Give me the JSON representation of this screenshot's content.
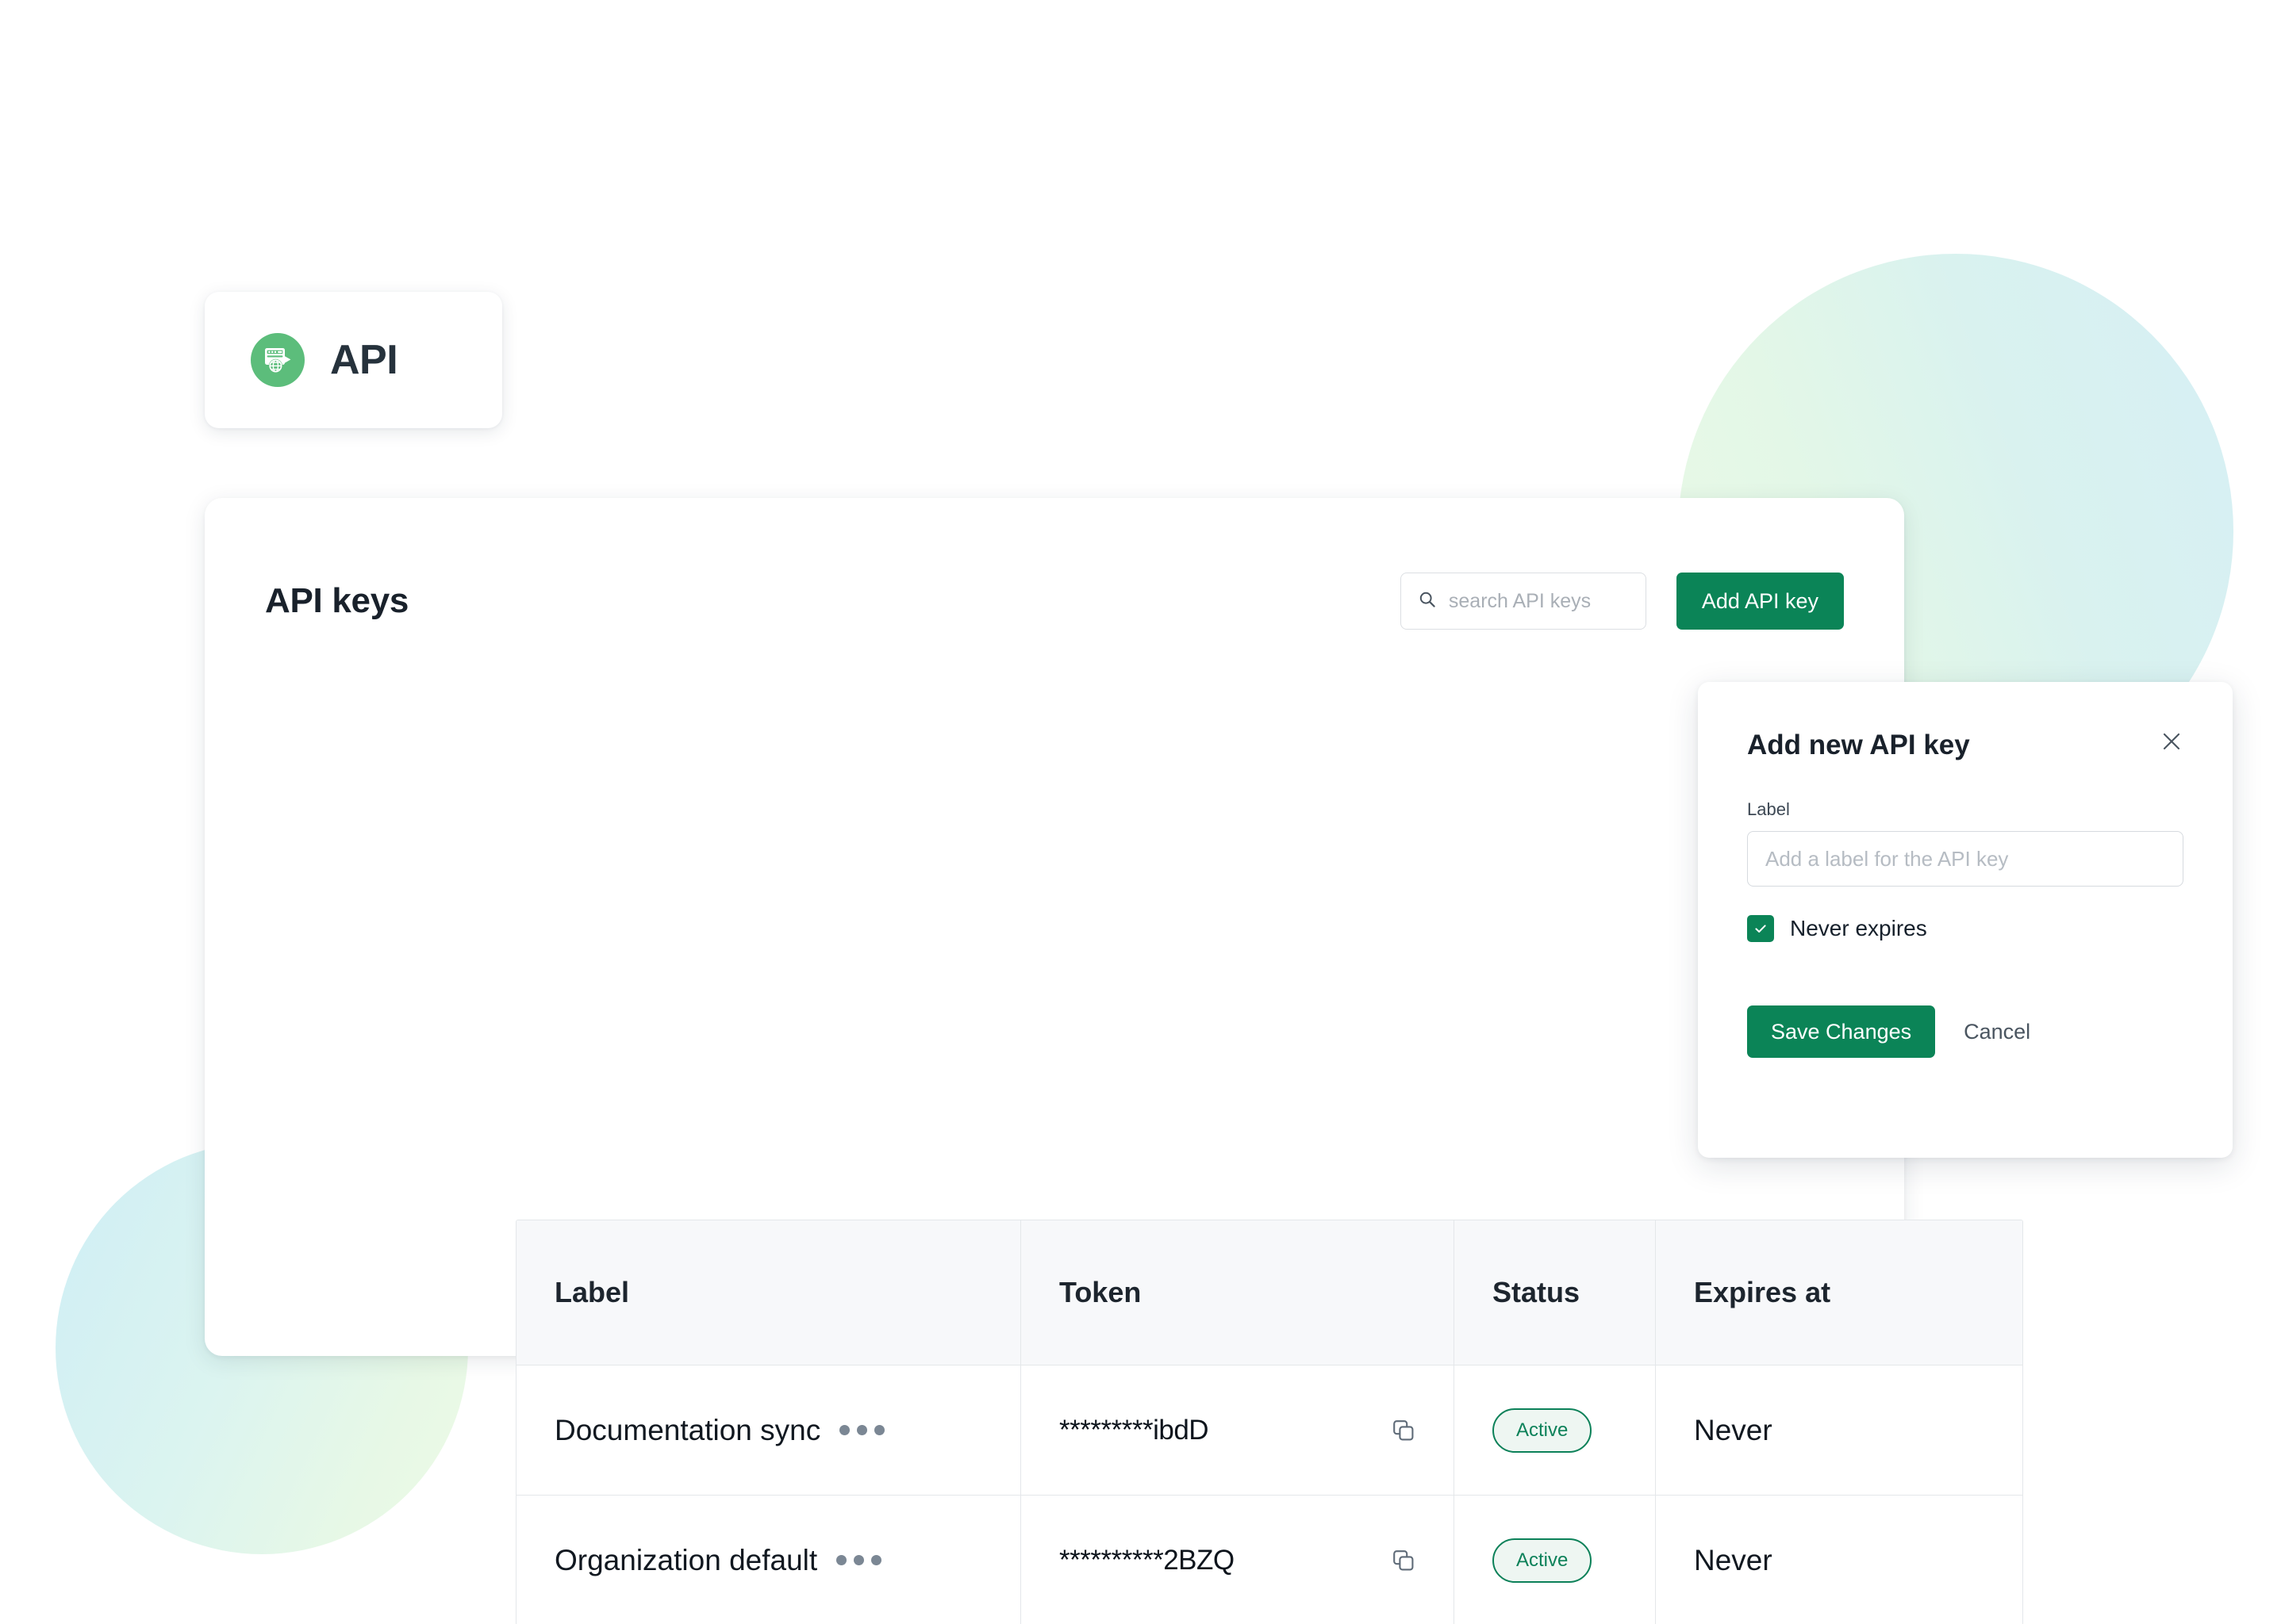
{
  "badge": {
    "title": "API",
    "icon": "api-globe-icon"
  },
  "panel": {
    "title": "API keys",
    "search": {
      "placeholder": "search API keys",
      "value": "",
      "icon": "search-icon"
    },
    "add_button": "Add API key"
  },
  "table": {
    "columns": [
      "Label",
      "Token",
      "Status",
      "Expires at"
    ],
    "rows": [
      {
        "label": "Documentation sync",
        "menu_icon": "ellipsis-icon",
        "token": "*********ibdD",
        "copy_icon": "copy-icon",
        "status": "Active",
        "expires_at": "Never"
      },
      {
        "label": "Organization default",
        "menu_icon": "ellipsis-icon",
        "token": "**********2BZQ",
        "copy_icon": "copy-icon",
        "status": "Active",
        "expires_at": "Never"
      }
    ]
  },
  "modal": {
    "title": "Add new API key",
    "close_icon": "close-icon",
    "label_field": {
      "label": "Label",
      "placeholder": "Add a label for the API key",
      "value": ""
    },
    "never_expires": {
      "label": "Never expires",
      "checked": true,
      "check_icon": "check-icon"
    },
    "save_button": "Save Changes",
    "cancel_button": "Cancel"
  },
  "colors": {
    "primary_green": "#0b8457",
    "badge_green": "#5cbd7b",
    "status_green": "#0c8159",
    "text_dark": "#19212b",
    "border": "#e4e7ea",
    "header_bg": "#f7f8fa"
  }
}
